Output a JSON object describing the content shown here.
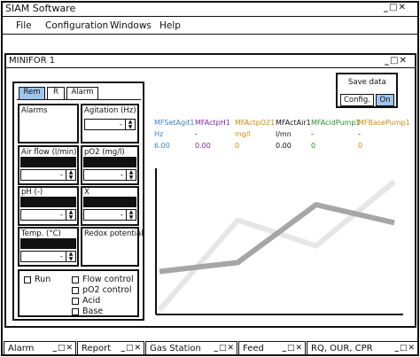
{
  "app": {
    "title": "SIAM Software",
    "window_controls": "_□✕"
  },
  "menu": [
    "File",
    "Configuration",
    "Windows",
    "Help"
  ],
  "subwindow": {
    "title": "MINIFOR 1",
    "controls": "_□✕"
  },
  "tabs": [
    "Rem",
    "R",
    "Alarm"
  ],
  "panels": {
    "alarms": "Alarms",
    "agitation": "Agitation (Hz)",
    "airflow": "Air flow (l/min)",
    "po2": "pO2 (mg/l)",
    "ph": "pH (-)",
    "x": "X",
    "temp": "Temp. (°C)",
    "redox": "Redox potential",
    "spin_value": "-"
  },
  "checks": {
    "run": "Run",
    "flow": "Flow control",
    "po2": "pO2 control",
    "acid": "Acid",
    "base": "Base"
  },
  "save": {
    "title": "Save data",
    "config": "Config.",
    "on": "On"
  },
  "metrics": [
    {
      "name": "MFSetAgit1",
      "unit": "Hz",
      "value": "6.00",
      "color": "#3b82c4"
    },
    {
      "name": "MFActpH1",
      "unit": "-",
      "value": "0.00",
      "color": "#7a2da0"
    },
    {
      "name": "MFActpO21",
      "unit": "mg/l",
      "value": "0",
      "color": "#c98a1a"
    },
    {
      "name": "MFActAir1",
      "unit": "l/mn",
      "value": "0.00",
      "color": "#111111"
    },
    {
      "name": "MFAcidPump1",
      "unit": "-",
      "value": "0",
      "color": "#2e8b2e"
    },
    {
      "name": "MFBasePump1",
      "unit": "-",
      "value": "0",
      "color": "#c98a1a"
    }
  ],
  "bottom_tabs": [
    {
      "label": "Alarm",
      "controls": "_□✕"
    },
    {
      "label": "Report",
      "controls": "_□✕"
    },
    {
      "label": "Gas Station",
      "controls": "_□✕"
    },
    {
      "label": "Feed",
      "controls": "_□✕"
    },
    {
      "label": "RQ, OUR, CPR",
      "controls": "_□✕"
    }
  ],
  "chart_data": {
    "type": "line",
    "title": "",
    "xlabel": "",
    "ylabel": "",
    "series": [
      {
        "values": [
          0.0,
          0.7,
          0.5,
          1.0
        ],
        "color": "#e6e6e6"
      },
      {
        "values": [
          0.3,
          0.37,
          0.82,
          0.68
        ],
        "color": "#a6a6a6"
      }
    ],
    "grid": false
  }
}
